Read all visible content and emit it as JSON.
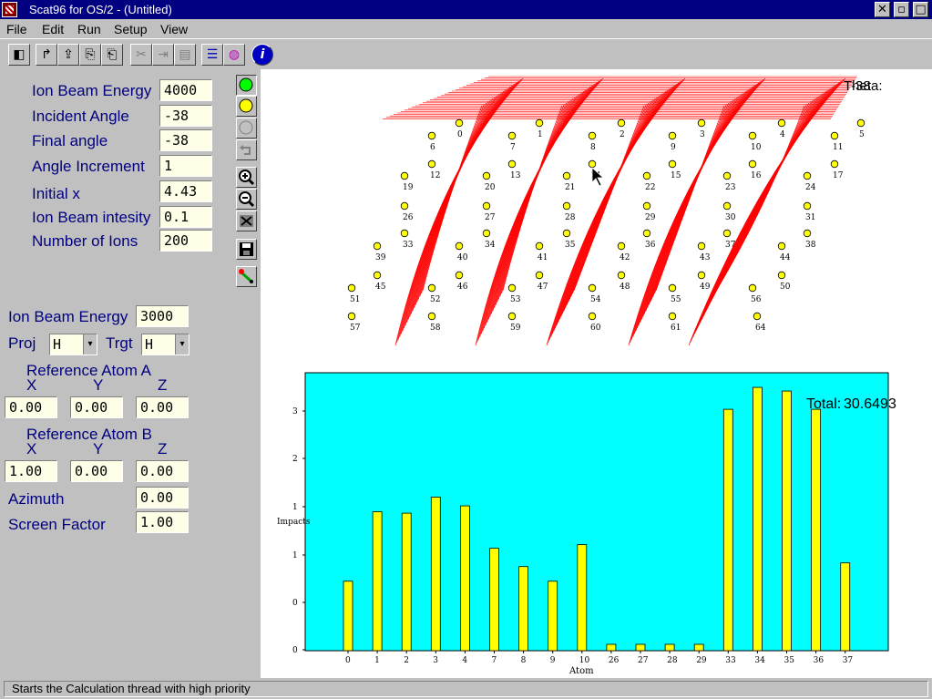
{
  "window": {
    "title": "Scat96 for OS/2 - (Untitled)"
  },
  "menu": [
    "File",
    "Edit",
    "Run",
    "Setup",
    "View"
  ],
  "toolbar": [
    {
      "name": "exit-icon",
      "glyph": "◧",
      "enabled": true
    },
    {
      "name": "open-icon",
      "glyph": "↱",
      "enabled": true
    },
    {
      "name": "save-icon",
      "glyph": "⇪",
      "enabled": true
    },
    {
      "name": "copy-doc-icon",
      "glyph": "⎘",
      "enabled": true
    },
    {
      "name": "paste-doc-icon",
      "glyph": "⎗",
      "enabled": true
    },
    {
      "name": "cut-icon",
      "glyph": "✂",
      "enabled": false
    },
    {
      "name": "replace-icon",
      "glyph": "⇥",
      "enabled": false
    },
    {
      "name": "paste-icon",
      "glyph": "▤",
      "enabled": false
    },
    {
      "name": "list-view-icon",
      "glyph": "☰",
      "enabled": true
    },
    {
      "name": "color-wheel-icon",
      "glyph": "◍",
      "enabled": true
    },
    {
      "name": "info-icon",
      "glyph": "i",
      "enabled": true
    }
  ],
  "parameters": [
    {
      "label": "Ion Beam Energy",
      "value": "4000"
    },
    {
      "label": "Incident Angle",
      "value": "-38"
    },
    {
      "label": "Final angle",
      "value": "-38"
    },
    {
      "label": "Angle Increment",
      "value": "1"
    },
    {
      "label": "Initial x",
      "value": "4.43"
    },
    {
      "label": "Ion Beam intesity",
      "value": "0.1"
    },
    {
      "label": "Number of Ions",
      "value": "200"
    }
  ],
  "energy2": {
    "label": "Ion Beam Energy",
    "value": "3000"
  },
  "proj": {
    "label": "Proj",
    "value": "H"
  },
  "trgt": {
    "label": "Trgt",
    "value": "H"
  },
  "refA": {
    "title": "Reference Atom A",
    "x": "0.00",
    "y": "0.00",
    "z": "0.00"
  },
  "refB": {
    "title": "Reference Atom B",
    "x": "1.00",
    "y": "0.00",
    "z": "0.00"
  },
  "axis_labels": {
    "x": "X",
    "y": "Y",
    "z": "Z"
  },
  "azimuth": {
    "label": "Azimuth",
    "value": "0.00"
  },
  "screen_factor": {
    "label": "Screen Factor",
    "value": "1.00"
  },
  "scatter_view": {
    "theta_text": "Theta:",
    "theta_value": "-38",
    "atom_color": "#ffff00",
    "trajectory_color": "#ff0000",
    "atom_labels": [
      "0",
      "1",
      "2",
      "3",
      "4",
      "5",
      "6",
      "7",
      "8",
      "9",
      "10",
      "11",
      "12",
      "13",
      "14",
      "15",
      "16",
      "17",
      "19",
      "20",
      "21",
      "22",
      "23",
      "24",
      "26",
      "27",
      "28",
      "29",
      "30",
      "31",
      "33",
      "34",
      "35",
      "36",
      "37",
      "38",
      "39",
      "40",
      "41",
      "42",
      "43",
      "44",
      "45",
      "46",
      "47",
      "48",
      "49",
      "50",
      "51",
      "52",
      "53",
      "54",
      "55",
      "56",
      "57",
      "58",
      "59",
      "60",
      "61",
      "64"
    ]
  },
  "chart_data": {
    "type": "bar",
    "categories": [
      "0",
      "1",
      "2",
      "3",
      "4",
      "7",
      "8",
      "9",
      "10",
      "26",
      "27",
      "28",
      "29",
      "33",
      "34",
      "35",
      "36",
      "37"
    ],
    "values": [
      0.95,
      1.9,
      1.88,
      2.1,
      1.98,
      1.4,
      1.15,
      0.95,
      1.45,
      0.08,
      0.08,
      0.08,
      0.08,
      3.3,
      3.6,
      3.55,
      3.3,
      1.2
    ],
    "xlabel": "Atom",
    "ylabel": "Impacts",
    "yticks": [
      "0",
      "0",
      "1",
      "1",
      "2",
      "3"
    ],
    "total_text": "Total:",
    "total_value": "30.6493",
    "background": "#00ffff",
    "bar_color": "#ffff00"
  },
  "status": "Starts the Calculation thread with high priority"
}
